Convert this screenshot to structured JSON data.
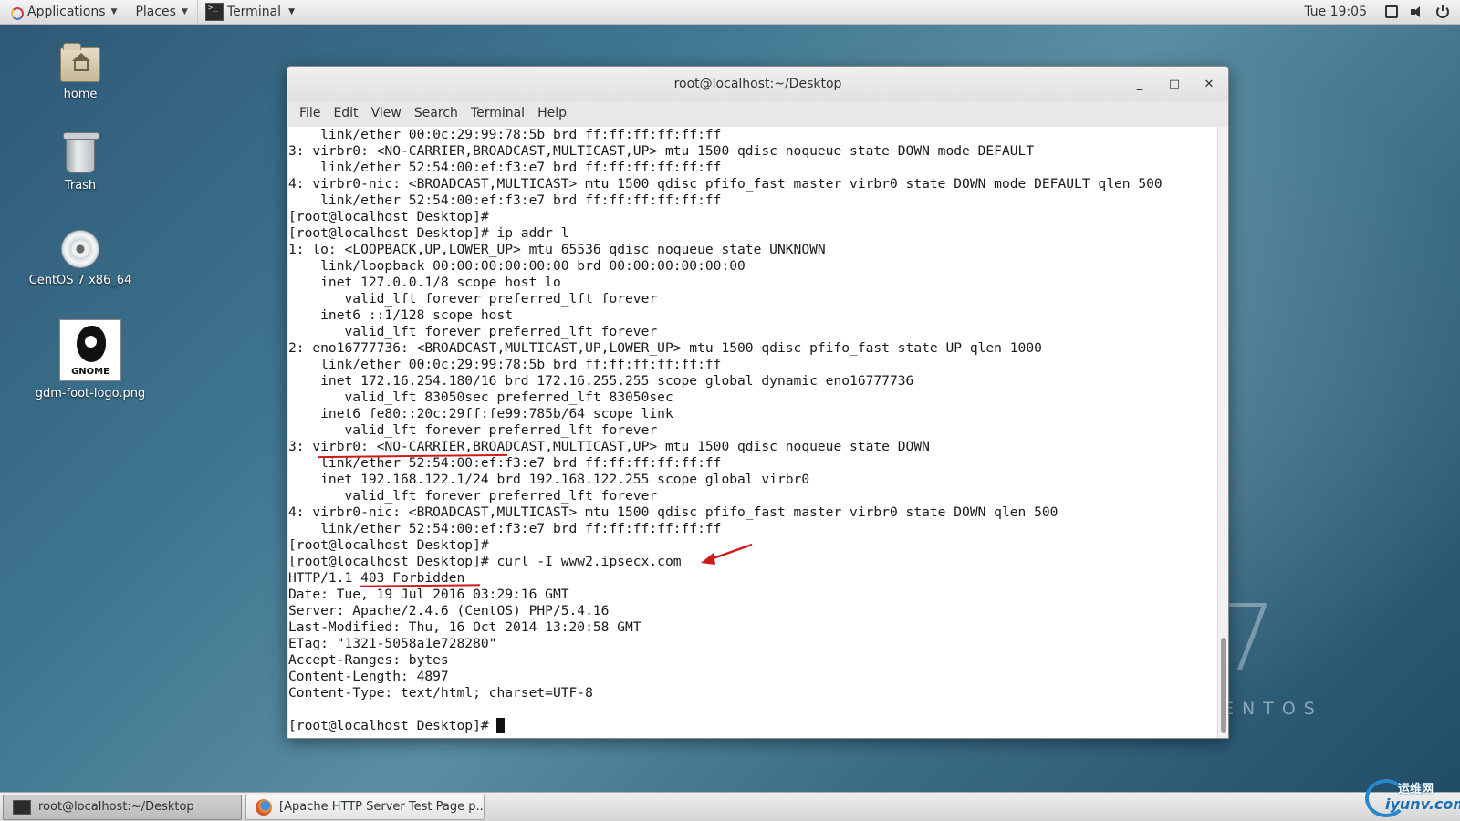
{
  "topbar": {
    "applications_label": "Applications",
    "places_label": "Places",
    "terminal_label": "Terminal",
    "clock": "Tue 19:05",
    "icons": [
      "display-icon",
      "volume-icon",
      "power-icon"
    ]
  },
  "desktop": {
    "icons": [
      {
        "label": "home",
        "icon": "home-folder-icon"
      },
      {
        "label": "Trash",
        "icon": "trash-icon"
      },
      {
        "label": "CentOS 7 x86_64",
        "icon": "disc-icon"
      },
      {
        "label": "gdm-foot-logo.png",
        "icon": "image-file-icon",
        "thumb_text": "GNOME"
      }
    ],
    "watermark_number": "7",
    "watermark_word": "ENTOS"
  },
  "window": {
    "title": "root@localhost:~/Desktop",
    "controls": {
      "minimize": "_",
      "maximize": "□",
      "close": "✕"
    },
    "menu": [
      "File",
      "Edit",
      "View",
      "Search",
      "Terminal",
      "Help"
    ],
    "terminal_lines": [
      "    link/ether 00:0c:29:99:78:5b brd ff:ff:ff:ff:ff:ff",
      "3: virbr0: <NO-CARRIER,BROADCAST,MULTICAST,UP> mtu 1500 qdisc noqueue state DOWN mode DEFAULT",
      "    link/ether 52:54:00:ef:f3:e7 brd ff:ff:ff:ff:ff:ff",
      "4: virbr0-nic: <BROADCAST,MULTICAST> mtu 1500 qdisc pfifo_fast master virbr0 state DOWN mode DEFAULT qlen 500",
      "    link/ether 52:54:00:ef:f3:e7 brd ff:ff:ff:ff:ff:ff",
      "[root@localhost Desktop]#",
      "[root@localhost Desktop]# ip addr l",
      "1: lo: <LOOPBACK,UP,LOWER_UP> mtu 65536 qdisc noqueue state UNKNOWN",
      "    link/loopback 00:00:00:00:00:00 brd 00:00:00:00:00:00",
      "    inet 127.0.0.1/8 scope host lo",
      "       valid_lft forever preferred_lft forever",
      "    inet6 ::1/128 scope host",
      "       valid_lft forever preferred_lft forever",
      "2: eno16777736: <BROADCAST,MULTICAST,UP,LOWER_UP> mtu 1500 qdisc pfifo_fast state UP qlen 1000",
      "    link/ether 00:0c:29:99:78:5b brd ff:ff:ff:ff:ff:ff",
      "    inet 172.16.254.180/16 brd 172.16.255.255 scope global dynamic eno16777736",
      "       valid_lft 83050sec preferred_lft 83050sec",
      "    inet6 fe80::20c:29ff:fe99:785b/64 scope link",
      "       valid_lft forever preferred_lft forever",
      "3: virbr0: <NO-CARRIER,BROADCAST,MULTICAST,UP> mtu 1500 qdisc noqueue state DOWN",
      "    link/ether 52:54:00:ef:f3:e7 brd ff:ff:ff:ff:ff:ff",
      "    inet 192.168.122.1/24 brd 192.168.122.255 scope global virbr0",
      "       valid_lft forever preferred_lft forever",
      "4: virbr0-nic: <BROADCAST,MULTICAST> mtu 1500 qdisc pfifo_fast master virbr0 state DOWN qlen 500",
      "    link/ether 52:54:00:ef:f3:e7 brd ff:ff:ff:ff:ff:ff",
      "[root@localhost Desktop]#",
      "[root@localhost Desktop]# curl -I www2.ipsecx.com",
      "HTTP/1.1 403 Forbidden",
      "Date: Tue, 19 Jul 2016 03:29:16 GMT",
      "Server: Apache/2.4.6 (CentOS) PHP/5.4.16",
      "Last-Modified: Thu, 16 Oct 2014 13:20:58 GMT",
      "ETag: \"1321-5058a1e728280\"",
      "Accept-Ranges: bytes",
      "Content-Length: 4897",
      "Content-Type: text/html; charset=UTF-8",
      "",
      "[root@localhost Desktop]# "
    ]
  },
  "taskbar": {
    "items": [
      {
        "label": "root@localhost:~/Desktop",
        "icon": "terminal-icon",
        "active": true
      },
      {
        "label": "[Apache HTTP Server Test Page p...",
        "icon": "firefox-icon",
        "active": false
      }
    ]
  },
  "site_logo": {
    "line1": "运维网",
    "line2": "iyunv.com"
  },
  "colors": {
    "annotation_red": "#d0191b",
    "desktop_blue": "#3f7590",
    "logo_blue": "#1e6fb4"
  }
}
